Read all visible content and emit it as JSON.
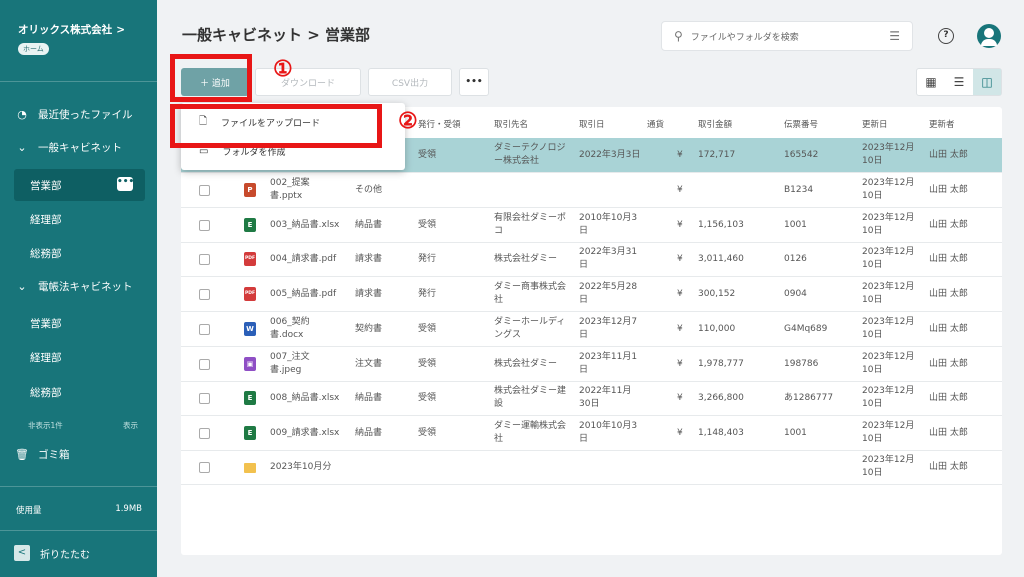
{
  "sidebar": {
    "company": "オリックス株式会社",
    "company_chevron": ">",
    "home_badge": "ホーム",
    "recent": "最近使ったファイル",
    "general_cabinet": "一般キャビネット",
    "general_items": [
      "営業部",
      "経理部",
      "総務部"
    ],
    "ledger_cabinet": "電帳法キャビネット",
    "ledger_items": [
      "営業部",
      "経理部",
      "総務部"
    ],
    "hidden_count": "非表示1件",
    "show_label": "表示",
    "trash": "ゴミ箱",
    "usage_label": "使用量",
    "usage_value": "1.9MB",
    "collapse": "折りたたむ",
    "collapse_icon": "<"
  },
  "header": {
    "breadcrumb": "一般キャビネット > 営業部",
    "search_placeholder": "ファイルやフォルダを検索",
    "help_icon": "?"
  },
  "toolbar": {
    "add_label": "＋ 追加",
    "download_label": "ダウンロード",
    "csv_label": "CSV出力",
    "more_label": "•••"
  },
  "dropdown": {
    "upload_label": "ファイルをアップロード",
    "create_folder_label": "フォルダを作成"
  },
  "annotations": [
    "①",
    "②"
  ],
  "table": {
    "headers": [
      "発行・受領",
      "取引先名",
      "取引日",
      "通貨",
      "取引金額",
      "伝票番号",
      "更新日",
      "更新者"
    ],
    "rows": [
      {
        "name": "",
        "type": "",
        "issue": "受領",
        "partner": "ダミーテクノロジー株式会社",
        "date": "2022年3月3日",
        "cur": "¥",
        "amount": "172,717",
        "voucher": "165542",
        "updated": "2023年12月10日",
        "user": "山田 太郎",
        "icon": "",
        "selected": true
      },
      {
        "name": "002_提案書.pptx",
        "type": "その他",
        "issue": "",
        "partner": "",
        "date": "",
        "cur": "¥",
        "amount": "",
        "voucher": "B1234",
        "updated": "2023年12月10日",
        "user": "山田 太郎",
        "icon": "p"
      },
      {
        "name": "003_納品書.xlsx",
        "type": "納品書",
        "issue": "受領",
        "partner": "有限会社ダミーポコ",
        "date": "2010年10月3日",
        "cur": "¥",
        "amount": "1,156,103",
        "voucher": "1001",
        "updated": "2023年12月10日",
        "user": "山田 太郎",
        "icon": "e"
      },
      {
        "name": "004_請求書.pdf",
        "type": "請求書",
        "issue": "発行",
        "partner": "株式会社ダミー",
        "date": "2022年3月31日",
        "cur": "¥",
        "amount": "3,011,460",
        "voucher": "0126",
        "updated": "2023年12月10日",
        "user": "山田 太郎",
        "icon": "pdf"
      },
      {
        "name": "005_納品書.pdf",
        "type": "請求書",
        "issue": "発行",
        "partner": "ダミー商事株式会社",
        "date": "2022年5月28日",
        "cur": "¥",
        "amount": "300,152",
        "voucher": "0904",
        "updated": "2023年12月10日",
        "user": "山田 太郎",
        "icon": "pdf"
      },
      {
        "name": "006_契約書.docx",
        "type": "契約書",
        "issue": "受領",
        "partner": "ダミーホールディングス",
        "date": "2023年12月7日",
        "cur": "¥",
        "amount": "110,000",
        "voucher": "G4Mq689",
        "updated": "2023年12月10日",
        "user": "山田 太郎",
        "icon": "w"
      },
      {
        "name": "007_注文書.jpeg",
        "type": "注文書",
        "issue": "受領",
        "partner": "株式会社ダミー",
        "date": "2023年11月1日",
        "cur": "¥",
        "amount": "1,978,777",
        "voucher": "198786",
        "updated": "2023年12月10日",
        "user": "山田 太郎",
        "icon": "img"
      },
      {
        "name": "008_納品書.xlsx",
        "type": "納品書",
        "issue": "受領",
        "partner": "株式会社ダミー建設",
        "date": "2022年11月30日",
        "cur": "¥",
        "amount": "3,266,800",
        "voucher": "あ1286777",
        "updated": "2023年12月10日",
        "user": "山田 太郎",
        "icon": "e"
      },
      {
        "name": "009_請求書.xlsx",
        "type": "納品書",
        "issue": "受領",
        "partner": "ダミー運輸株式会社",
        "date": "2010年10月3日",
        "cur": "¥",
        "amount": "1,148,403",
        "voucher": "1001",
        "updated": "2023年12月10日",
        "user": "山田 太郎",
        "icon": "e"
      },
      {
        "name": "2023年10月分",
        "type": "",
        "issue": "",
        "partner": "",
        "date": "",
        "cur": "",
        "amount": "",
        "voucher": "",
        "updated": "2023年12月10日",
        "user": "山田 太郎",
        "icon": "folder"
      }
    ]
  }
}
